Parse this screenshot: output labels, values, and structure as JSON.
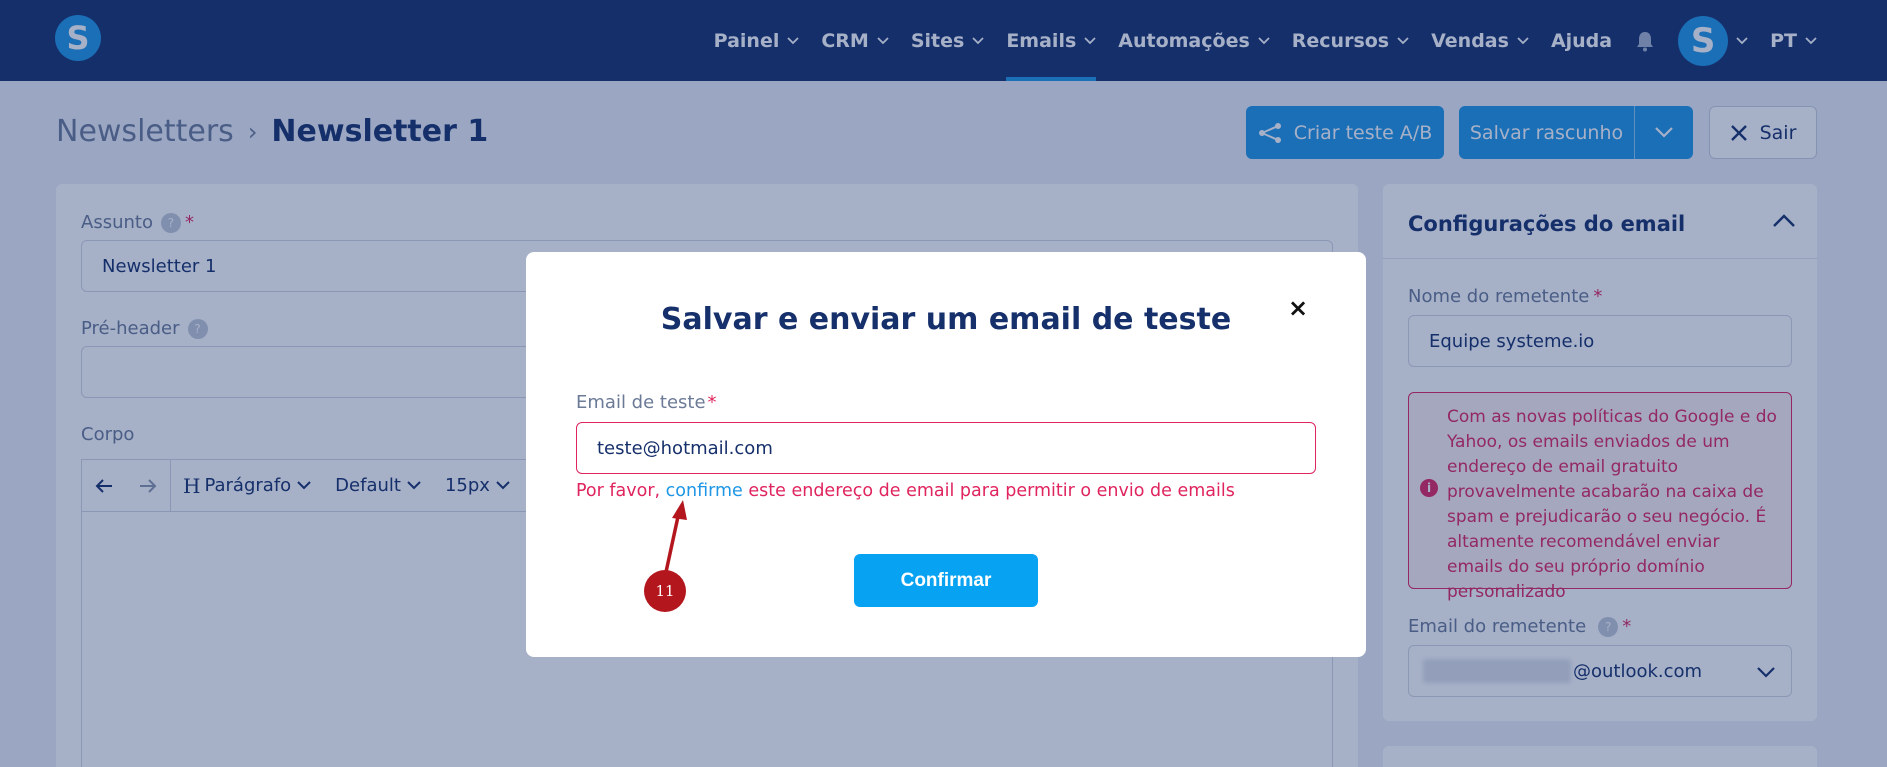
{
  "app": {
    "logo_letter": "S"
  },
  "nav": {
    "items": [
      {
        "label": "Painel",
        "has_menu": true
      },
      {
        "label": "CRM",
        "has_menu": true
      },
      {
        "label": "Sites",
        "has_menu": true
      },
      {
        "label": "Emails",
        "has_menu": true,
        "active": true
      },
      {
        "label": "Automações",
        "has_menu": true
      },
      {
        "label": "Recursos",
        "has_menu": true
      },
      {
        "label": "Vendas",
        "has_menu": true
      },
      {
        "label": "Ajuda",
        "has_menu": false
      }
    ],
    "avatar_letter": "S",
    "language": "PT"
  },
  "breadcrumb": {
    "parent": "Newsletters",
    "separator": "›",
    "current": "Newsletter 1"
  },
  "header_actions": {
    "ab_test": "Criar teste A/B",
    "save_draft": "Salvar rascunho",
    "exit": "Sair"
  },
  "editor": {
    "subject_label": "Assunto",
    "subject_value": "Newsletter 1",
    "preheader_label": "Pré-header",
    "preheader_value": "",
    "body_label": "Corpo",
    "help_glyph": "?",
    "required_mark": "*",
    "toolbar": {
      "paragraph": "Parágrafo",
      "font": "Default",
      "size": "15px"
    }
  },
  "sidebar": {
    "title": "Configurações do email",
    "sender_name_label": "Nome do remetente",
    "sender_name_value": "Equipe systeme.io",
    "warning_text": "Com as novas políticas do Google e do Yahoo, os emails enviados de um endereço de email gratuito provavelmente acabarão na caixa de spam e prejudicarão o seu negócio. É altamente recomendável enviar emails do seu próprio domínio personalizado",
    "warning_icon": "i",
    "sender_email_label": "Email do remetente",
    "sender_email_domain": "@outlook.com"
  },
  "modal": {
    "title": "Salvar e enviar um email de teste",
    "close_glyph": "×",
    "field_label": "Email de teste",
    "required_mark": "*",
    "field_value": "teste@hotmail.com",
    "error_prefix": "Por favor, ",
    "error_link": "confirme",
    "error_suffix": " este endereço de email para permitir o envio de emails",
    "confirm_button": "Confirmar"
  },
  "annotation": {
    "step_number": "11",
    "color": "#b3161d"
  },
  "colors": {
    "nav_bg": "#16306b",
    "accent": "#1d96e5",
    "error": "#e0245e",
    "confirm": "#07a2f1"
  }
}
